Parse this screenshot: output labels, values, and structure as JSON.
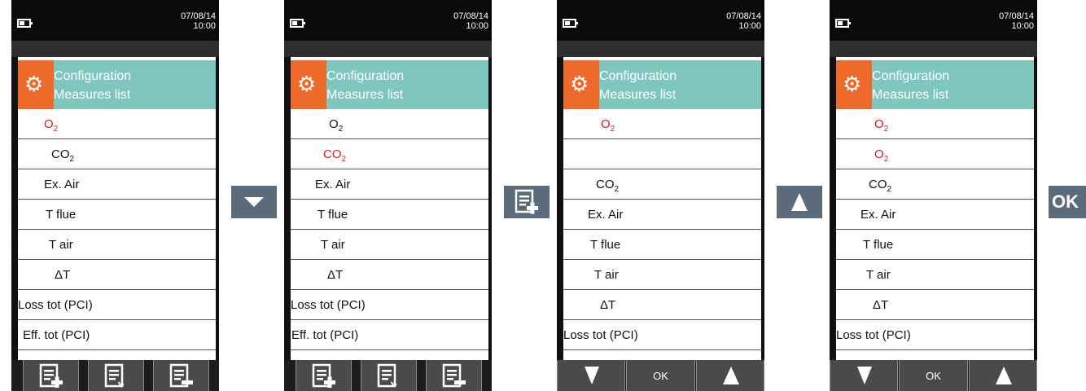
{
  "statusbar": {
    "date": "07/08/14",
    "time": "10:00"
  },
  "header": {
    "line1": "Configuration",
    "line2": "Measures list"
  },
  "screens": [
    {
      "rows": [
        "O₂",
        "CO₂",
        "Ex. Air",
        "T flue",
        "T air",
        "ΔT",
        "Loss tot (PCI)",
        "Eff. tot (PCI)"
      ],
      "highlight": [
        0
      ]
    },
    {
      "rows": [
        "O₂",
        "CO₂",
        "Ex. Air",
        "T flue",
        "T air",
        "ΔT",
        "Loss tot (PCI)",
        "Eff. tot (PCI)"
      ],
      "highlight": [
        1
      ]
    },
    {
      "rows": [
        "O₂",
        "",
        "CO₂",
        "Ex. Air",
        "T flue",
        "T air",
        "ΔT",
        "Loss tot (PCI)"
      ],
      "highlight": [
        0
      ]
    },
    {
      "rows": [
        "O₂",
        "O₂",
        "CO₂",
        "Ex. Air",
        "T flue",
        "T air",
        "ΔT",
        "Loss tot (PCI)"
      ],
      "highlight": [
        0,
        1
      ]
    }
  ],
  "softkeys": {
    "ok_label": "OK"
  },
  "transitions": {
    "ok_label": "OK"
  },
  "icons": {
    "add": "list-add-icon",
    "move": "list-move-icon",
    "remove": "list-remove-icon",
    "down": "arrow-down-icon",
    "up": "arrow-up-icon",
    "settings": "gear-icon",
    "battery": "battery-icon"
  },
  "colors": {
    "header": "#7fc6bf",
    "gear_box": "#ee6a2a",
    "highlight_text": "#e01a1a",
    "transition_button": "#5b6b7a"
  }
}
